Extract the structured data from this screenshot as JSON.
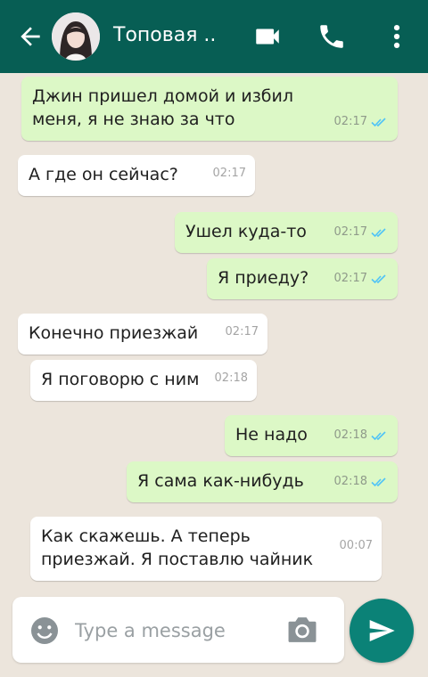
{
  "header": {
    "contact_name": "Топовая ..",
    "icons": [
      "back-arrow-icon",
      "video-call-icon",
      "phone-icon",
      "more-vert-icon"
    ],
    "color": "#075e54"
  },
  "messages": [
    {
      "direction": "out",
      "text": "Джин пришел домой и избил\nменя, я не знаю за что",
      "time": "02:17",
      "status": "read"
    },
    {
      "direction": "in",
      "text": "А где он сейчас?",
      "time": "02:17"
    },
    {
      "direction": "out",
      "text": "Ушел куда-то",
      "time": "02:17",
      "status": "read"
    },
    {
      "direction": "out",
      "text": "Я приеду?",
      "time": "02:17",
      "status": "read"
    },
    {
      "direction": "in",
      "text": "Конечно приезжай",
      "time": "02:17"
    },
    {
      "direction": "in",
      "text": "Я поговорю с ним",
      "time": "02:18"
    },
    {
      "direction": "out",
      "text": "Не надо",
      "time": "02:18",
      "status": "read"
    },
    {
      "direction": "out",
      "text": "Я сама как-нибудь",
      "time": "02:18",
      "status": "read"
    },
    {
      "direction": "in",
      "text": "Как скажешь. А теперь\nприезжай. Я поставлю чайник",
      "time": "00:07"
    }
  ],
  "composer": {
    "placeholder": "Type a message",
    "value": "",
    "icons": [
      "emoji-icon",
      "camera-icon",
      "send-icon"
    ]
  },
  "colors": {
    "outgoing_bubble": "#dcf8c6",
    "incoming_bubble": "#ffffff",
    "read_tick": "#4fc3f7",
    "send_button": "#0b8277"
  }
}
